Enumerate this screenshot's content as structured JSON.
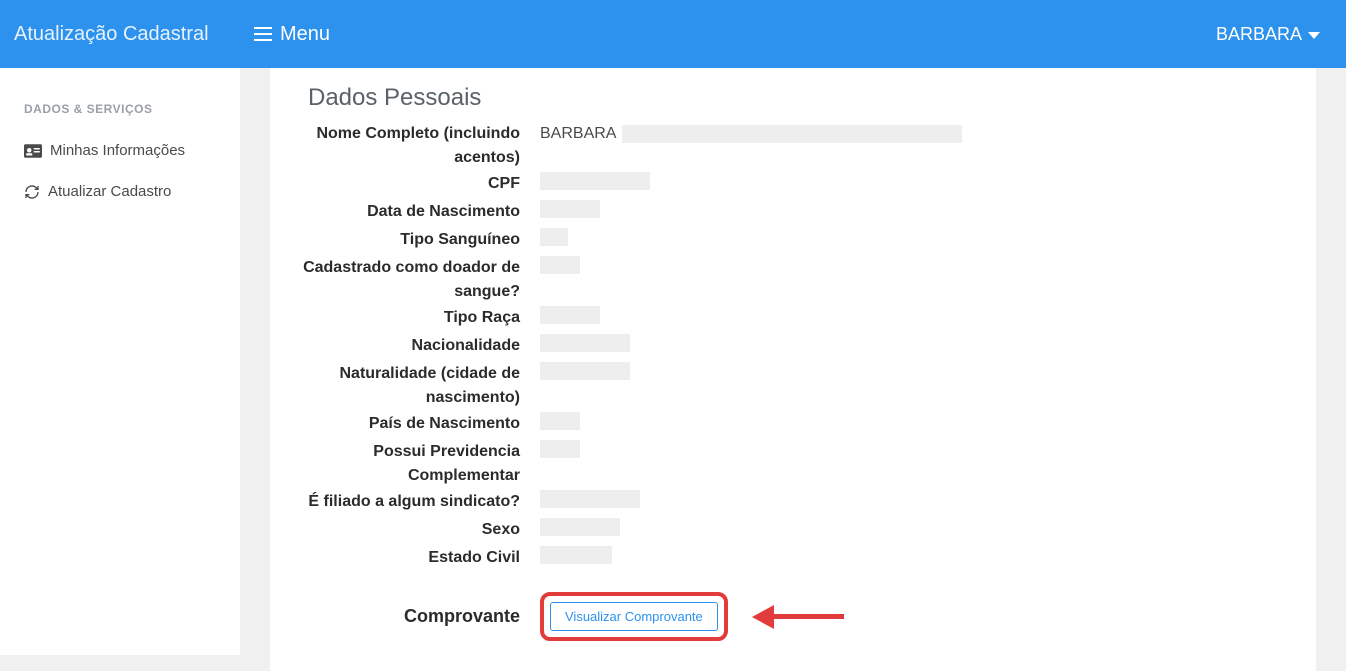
{
  "header": {
    "brand": "Atualização Cadastral",
    "menu_label": "Menu",
    "user_name": "BARBARA"
  },
  "sidebar": {
    "heading": "DADOS & SERVIÇOS",
    "items": [
      {
        "label": "Minhas Informações"
      },
      {
        "label": "Atualizar Cadastro"
      }
    ]
  },
  "section": {
    "title": "Dados Pessoais"
  },
  "fields": {
    "nome_completo_label": "Nome Completo (incluindo acentos)",
    "nome_completo_value": "BARBARA",
    "cpf_label": "CPF",
    "data_nascimento_label": "Data de Nascimento",
    "tipo_sanguineo_label": "Tipo Sanguíneo",
    "doador_label": "Cadastrado como doador de sangue?",
    "tipo_raca_label": "Tipo Raça",
    "nacionalidade_label": "Nacionalidade",
    "naturalidade_label": "Naturalidade (cidade de nascimento)",
    "pais_nascimento_label": "País de Nascimento",
    "previdencia_label": "Possui Previdencia Complementar",
    "sindicato_label": "É filiado a algum sindicato?",
    "sexo_label": "Sexo",
    "estado_civil_label": "Estado Civil",
    "comprovante_label": "Comprovante",
    "visualizar_btn": "Visualizar Comprovante"
  }
}
